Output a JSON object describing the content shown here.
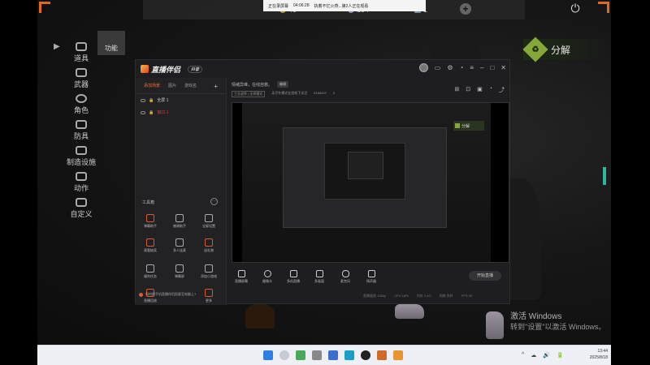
{
  "recording_bar": {
    "status": "正在录屏幕",
    "timer": "04:06:28",
    "message": "执着不忆火燕...第2人正在观看"
  },
  "hud": {
    "stat_1": "45",
    "stat_2": "154",
    "stat_3": "1",
    "plus": "+",
    "power": "⏻"
  },
  "game_menu": {
    "active_tab": "功能",
    "items": [
      "道具",
      "武器",
      "角色",
      "防具",
      "制造设施",
      "动作",
      "自定义"
    ]
  },
  "fenjie": {
    "label": "分解"
  },
  "app": {
    "name": "直播伴侣",
    "badge": "抖音",
    "scene_tabs": [
      "添加场景",
      "图片",
      "游戏名"
    ],
    "scenes": [
      "全屏 1",
      "窗口 1"
    ],
    "toolbox_title": "工具箱",
    "tools": [
      "弹幕助手",
      "感谢助手",
      "全屏设置",
      "观看抽奖",
      "多人连麦",
      "送礼物",
      "福利任务",
      "弹幕屏",
      "添加小游戏",
      "直播回放",
      "更多"
    ],
    "tip": "如何把手机直播伴侣投屏至电脑上?",
    "main_title": "情绪异维，在线自救。",
    "edit_label": "编辑",
    "sub_chip": "工业战争 | 无师模式",
    "sub_text_1": "无尽冬模式在游戏下次活",
    "sub_text_2": "6100247",
    "sub_text_3": "0",
    "bottom_tools": [
      "直播屏幕",
      "摄像头",
      "多机直播",
      "多画面",
      "麦克风",
      "扬声器"
    ],
    "start_button": "开始直播",
    "status": [
      "直播画质 1080p",
      "CPU 18%",
      "内存 2.4G",
      "网络 良好",
      "FPS 30"
    ]
  },
  "preview": {
    "green_label": "分解"
  },
  "windows_activation": {
    "title": "激活 Windows",
    "subtitle": "转到\"设置\"以激活 Windows。"
  },
  "taskbar": {
    "time": "13:44",
    "date": "2025/8/18",
    "tray": [
      "^",
      "☁",
      "🔊",
      "🔋"
    ]
  }
}
